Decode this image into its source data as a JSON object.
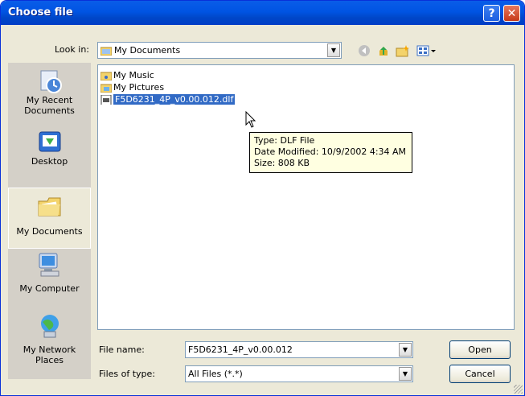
{
  "window": {
    "title": "Choose file"
  },
  "toolbar": {
    "look_in_label": "Look in:",
    "look_in_value": "My Documents"
  },
  "places": [
    {
      "label": "My Recent Documents",
      "icon": "recent-documents-icon"
    },
    {
      "label": "Desktop",
      "icon": "desktop-icon"
    },
    {
      "label": "My Documents",
      "icon": "my-documents-icon"
    },
    {
      "label": "My Computer",
      "icon": "my-computer-icon"
    },
    {
      "label": "My Network Places",
      "icon": "network-places-icon"
    }
  ],
  "files": [
    {
      "name": "My Music",
      "icon": "folder-icon"
    },
    {
      "name": "My Pictures",
      "icon": "folder-icon"
    },
    {
      "name": "F5D6231_4P_v0.00.012.dlf",
      "icon": "dlf-file-icon"
    }
  ],
  "tooltip": {
    "line1": "Type: DLF File",
    "line2": "Date Modified: 10/9/2002 4:34 AM",
    "line3": "Size: 808 KB"
  },
  "bottom": {
    "file_name_label": "File name:",
    "file_name_value": "F5D6231_4P_v0.00.012",
    "file_type_label": "Files of type:",
    "file_type_value": "All Files (*.*)",
    "open_label": "Open",
    "cancel_label": "Cancel"
  },
  "colors": {
    "titlebar": "#0054e3",
    "selection": "#316ac5",
    "tooltip_bg": "#ffffe1"
  }
}
